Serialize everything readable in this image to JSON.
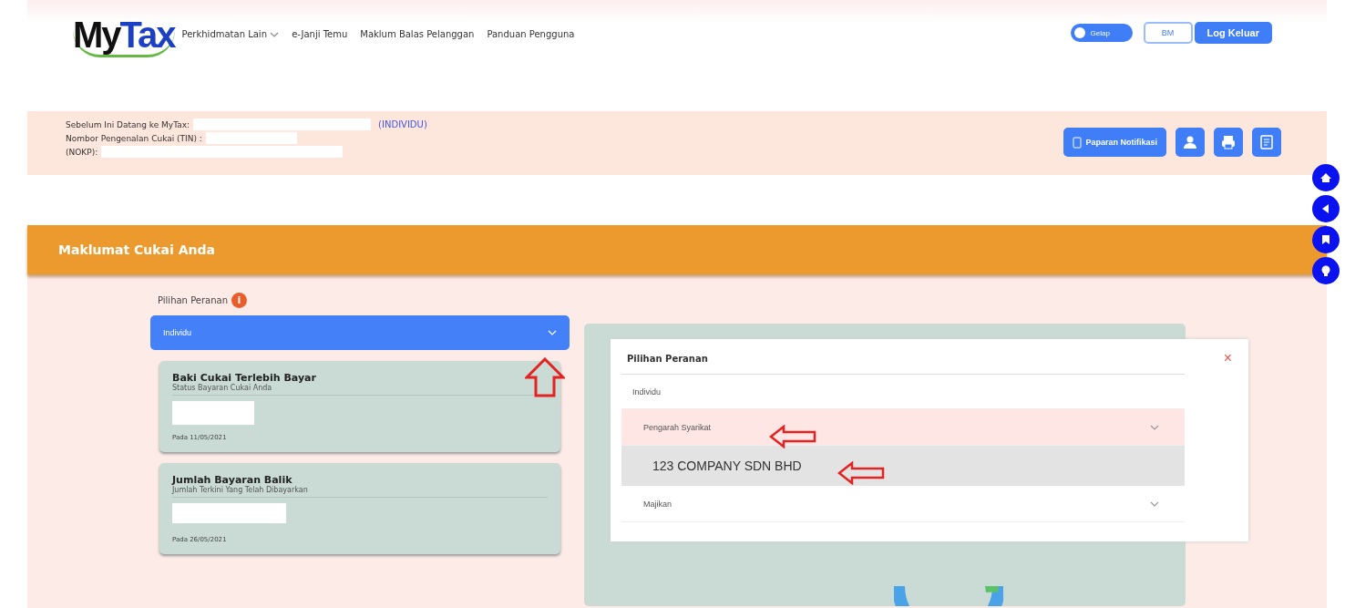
{
  "header": {
    "logo": "MyTax",
    "nav": [
      {
        "label": "Perkhidmatan Lain",
        "dropdown": true
      },
      {
        "label": "e-Janji Temu",
        "dropdown": false
      },
      {
        "label": "Maklum Balas Pelanggan",
        "dropdown": false
      },
      {
        "label": "Panduan Pengguna",
        "dropdown": false
      }
    ],
    "theme_toggle": {
      "label": "Gelap",
      "on": false
    },
    "language_button": "BM",
    "logout_button": "Log Keluar"
  },
  "user_info": {
    "lines": [
      {
        "label": "Sebelum Ini Datang ke MyTax:",
        "link": "(INDIVIDU)"
      },
      {
        "label": "Nombor Pengenalan Cukai (TIN) :"
      },
      {
        "label": "(NOKP):"
      }
    ],
    "notification_button": "Paparan Notifikasi",
    "icon_buttons": [
      {
        "kind": "user"
      },
      {
        "kind": "printer"
      },
      {
        "kind": "document"
      }
    ]
  },
  "side_buttons": [
    {
      "kind": "home"
    },
    {
      "kind": "back"
    },
    {
      "kind": "book"
    },
    {
      "kind": "bulb"
    }
  ],
  "banner": {
    "title": "Maklumat Cukai Anda"
  },
  "role_select": {
    "label": "Pilihan Peranan",
    "info": "i",
    "value": "Individu"
  },
  "cards": [
    {
      "title": "Baki Cukai Terlebih Bayar",
      "subtitle": "Status Bayaran Cukai Anda",
      "date": "Pada 11/05/2021"
    },
    {
      "title": "Jumlah Bayaran Balik",
      "subtitle": "Jumlah Terkini Yang Telah Dibayarkan",
      "date": "Pada 26/05/2021"
    }
  ],
  "role_modal": {
    "title": "Pilihan Peranan",
    "close": "×",
    "items": [
      {
        "label": "Individu",
        "kind": "plain",
        "selected": false
      },
      {
        "label": "Pengarah Syarikat",
        "kind": "group",
        "selected": true,
        "expanded": true,
        "children": [
          {
            "label": "123 COMPANY SDN BHD",
            "selected": true
          }
        ]
      },
      {
        "label": "Majikan",
        "kind": "group",
        "selected": false
      }
    ]
  },
  "annotations": [
    {
      "kind": "up"
    },
    {
      "kind": "left"
    },
    {
      "kind": "left"
    }
  ]
}
